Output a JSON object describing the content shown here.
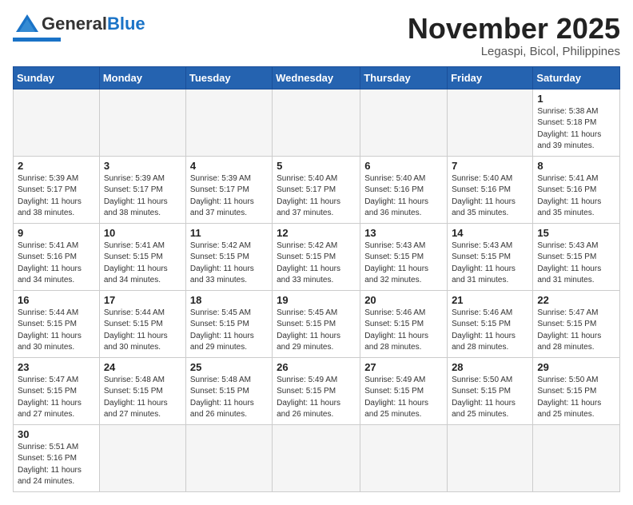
{
  "app": {
    "name": "GeneralBlue",
    "name_part1": "General",
    "name_part2": "Blue"
  },
  "header": {
    "month": "November 2025",
    "location": "Legaspi, Bicol, Philippines"
  },
  "weekdays": [
    "Sunday",
    "Monday",
    "Tuesday",
    "Wednesday",
    "Thursday",
    "Friday",
    "Saturday"
  ],
  "weeks": [
    [
      {
        "day": "",
        "sunrise": "",
        "sunset": "",
        "daylight": ""
      },
      {
        "day": "",
        "sunrise": "",
        "sunset": "",
        "daylight": ""
      },
      {
        "day": "",
        "sunrise": "",
        "sunset": "",
        "daylight": ""
      },
      {
        "day": "",
        "sunrise": "",
        "sunset": "",
        "daylight": ""
      },
      {
        "day": "",
        "sunrise": "",
        "sunset": "",
        "daylight": ""
      },
      {
        "day": "",
        "sunrise": "",
        "sunset": "",
        "daylight": ""
      },
      {
        "day": "1",
        "sunrise": "Sunrise: 5:38 AM",
        "sunset": "Sunset: 5:18 PM",
        "daylight": "Daylight: 11 hours and 39 minutes."
      }
    ],
    [
      {
        "day": "2",
        "sunrise": "Sunrise: 5:39 AM",
        "sunset": "Sunset: 5:17 PM",
        "daylight": "Daylight: 11 hours and 38 minutes."
      },
      {
        "day": "3",
        "sunrise": "Sunrise: 5:39 AM",
        "sunset": "Sunset: 5:17 PM",
        "daylight": "Daylight: 11 hours and 38 minutes."
      },
      {
        "day": "4",
        "sunrise": "Sunrise: 5:39 AM",
        "sunset": "Sunset: 5:17 PM",
        "daylight": "Daylight: 11 hours and 37 minutes."
      },
      {
        "day": "5",
        "sunrise": "Sunrise: 5:40 AM",
        "sunset": "Sunset: 5:17 PM",
        "daylight": "Daylight: 11 hours and 37 minutes."
      },
      {
        "day": "6",
        "sunrise": "Sunrise: 5:40 AM",
        "sunset": "Sunset: 5:16 PM",
        "daylight": "Daylight: 11 hours and 36 minutes."
      },
      {
        "day": "7",
        "sunrise": "Sunrise: 5:40 AM",
        "sunset": "Sunset: 5:16 PM",
        "daylight": "Daylight: 11 hours and 35 minutes."
      },
      {
        "day": "8",
        "sunrise": "Sunrise: 5:41 AM",
        "sunset": "Sunset: 5:16 PM",
        "daylight": "Daylight: 11 hours and 35 minutes."
      }
    ],
    [
      {
        "day": "9",
        "sunrise": "Sunrise: 5:41 AM",
        "sunset": "Sunset: 5:16 PM",
        "daylight": "Daylight: 11 hours and 34 minutes."
      },
      {
        "day": "10",
        "sunrise": "Sunrise: 5:41 AM",
        "sunset": "Sunset: 5:15 PM",
        "daylight": "Daylight: 11 hours and 34 minutes."
      },
      {
        "day": "11",
        "sunrise": "Sunrise: 5:42 AM",
        "sunset": "Sunset: 5:15 PM",
        "daylight": "Daylight: 11 hours and 33 minutes."
      },
      {
        "day": "12",
        "sunrise": "Sunrise: 5:42 AM",
        "sunset": "Sunset: 5:15 PM",
        "daylight": "Daylight: 11 hours and 33 minutes."
      },
      {
        "day": "13",
        "sunrise": "Sunrise: 5:43 AM",
        "sunset": "Sunset: 5:15 PM",
        "daylight": "Daylight: 11 hours and 32 minutes."
      },
      {
        "day": "14",
        "sunrise": "Sunrise: 5:43 AM",
        "sunset": "Sunset: 5:15 PM",
        "daylight": "Daylight: 11 hours and 31 minutes."
      },
      {
        "day": "15",
        "sunrise": "Sunrise: 5:43 AM",
        "sunset": "Sunset: 5:15 PM",
        "daylight": "Daylight: 11 hours and 31 minutes."
      }
    ],
    [
      {
        "day": "16",
        "sunrise": "Sunrise: 5:44 AM",
        "sunset": "Sunset: 5:15 PM",
        "daylight": "Daylight: 11 hours and 30 minutes."
      },
      {
        "day": "17",
        "sunrise": "Sunrise: 5:44 AM",
        "sunset": "Sunset: 5:15 PM",
        "daylight": "Daylight: 11 hours and 30 minutes."
      },
      {
        "day": "18",
        "sunrise": "Sunrise: 5:45 AM",
        "sunset": "Sunset: 5:15 PM",
        "daylight": "Daylight: 11 hours and 29 minutes."
      },
      {
        "day": "19",
        "sunrise": "Sunrise: 5:45 AM",
        "sunset": "Sunset: 5:15 PM",
        "daylight": "Daylight: 11 hours and 29 minutes."
      },
      {
        "day": "20",
        "sunrise": "Sunrise: 5:46 AM",
        "sunset": "Sunset: 5:15 PM",
        "daylight": "Daylight: 11 hours and 28 minutes."
      },
      {
        "day": "21",
        "sunrise": "Sunrise: 5:46 AM",
        "sunset": "Sunset: 5:15 PM",
        "daylight": "Daylight: 11 hours and 28 minutes."
      },
      {
        "day": "22",
        "sunrise": "Sunrise: 5:47 AM",
        "sunset": "Sunset: 5:15 PM",
        "daylight": "Daylight: 11 hours and 28 minutes."
      }
    ],
    [
      {
        "day": "23",
        "sunrise": "Sunrise: 5:47 AM",
        "sunset": "Sunset: 5:15 PM",
        "daylight": "Daylight: 11 hours and 27 minutes."
      },
      {
        "day": "24",
        "sunrise": "Sunrise: 5:48 AM",
        "sunset": "Sunset: 5:15 PM",
        "daylight": "Daylight: 11 hours and 27 minutes."
      },
      {
        "day": "25",
        "sunrise": "Sunrise: 5:48 AM",
        "sunset": "Sunset: 5:15 PM",
        "daylight": "Daylight: 11 hours and 26 minutes."
      },
      {
        "day": "26",
        "sunrise": "Sunrise: 5:49 AM",
        "sunset": "Sunset: 5:15 PM",
        "daylight": "Daylight: 11 hours and 26 minutes."
      },
      {
        "day": "27",
        "sunrise": "Sunrise: 5:49 AM",
        "sunset": "Sunset: 5:15 PM",
        "daylight": "Daylight: 11 hours and 25 minutes."
      },
      {
        "day": "28",
        "sunrise": "Sunrise: 5:50 AM",
        "sunset": "Sunset: 5:15 PM",
        "daylight": "Daylight: 11 hours and 25 minutes."
      },
      {
        "day": "29",
        "sunrise": "Sunrise: 5:50 AM",
        "sunset": "Sunset: 5:15 PM",
        "daylight": "Daylight: 11 hours and 25 minutes."
      }
    ],
    [
      {
        "day": "30",
        "sunrise": "Sunrise: 5:51 AM",
        "sunset": "Sunset: 5:16 PM",
        "daylight": "Daylight: 11 hours and 24 minutes."
      },
      {
        "day": "",
        "sunrise": "",
        "sunset": "",
        "daylight": ""
      },
      {
        "day": "",
        "sunrise": "",
        "sunset": "",
        "daylight": ""
      },
      {
        "day": "",
        "sunrise": "",
        "sunset": "",
        "daylight": ""
      },
      {
        "day": "",
        "sunrise": "",
        "sunset": "",
        "daylight": ""
      },
      {
        "day": "",
        "sunrise": "",
        "sunset": "",
        "daylight": ""
      },
      {
        "day": "",
        "sunrise": "",
        "sunset": "",
        "daylight": ""
      }
    ]
  ]
}
